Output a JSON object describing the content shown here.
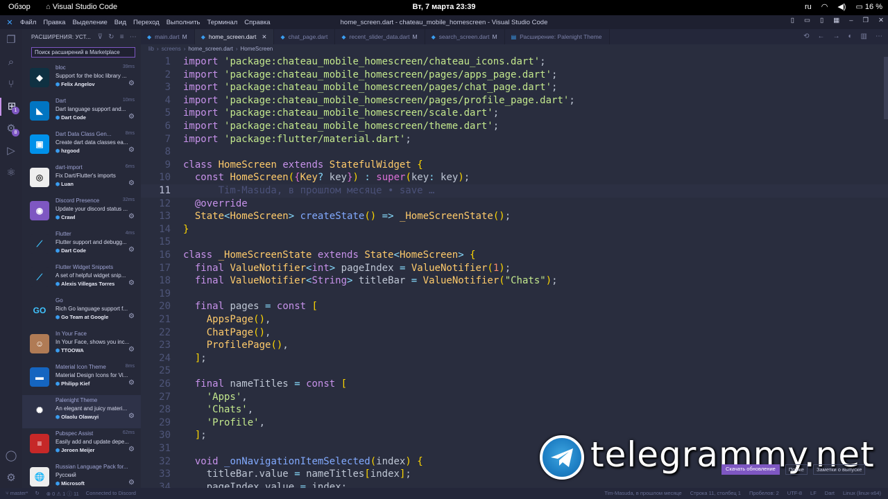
{
  "topbar": {
    "overview": "Обзор",
    "app": "Visual Studio Code",
    "datetime": "Вт, 7 марта  23:39",
    "lang": "ru",
    "battery": "16 %"
  },
  "menu": [
    "Файл",
    "Правка",
    "Выделение",
    "Вид",
    "Переход",
    "Выполнить",
    "Терминал",
    "Справка"
  ],
  "window_title": "home_screen.dart - chateau_mobile_homescreen - Visual Studio Code",
  "sidebar": {
    "title": "РАСШИРЕНИЯ: УСТ...",
    "search_placeholder": "Поиск расширений в Marketplace",
    "extensions": [
      {
        "name": "bloc",
        "time": "39ms",
        "desc": "Support for the bloc library ...",
        "publisher": "Felix Angelov",
        "icon_color": "#0f3142",
        "glyph": "◆"
      },
      {
        "name": "Dart",
        "time": "10ms",
        "desc": "Dart language support and...",
        "publisher": "Dart Code",
        "icon_color": "#0175c2",
        "glyph": "◣"
      },
      {
        "name": "Dart Data Class Gen...",
        "time": "8ms",
        "desc": "Create dart data classes ea...",
        "publisher": "hzgood",
        "icon_color": "#0091ea",
        "glyph": "▣"
      },
      {
        "name": "dart-import",
        "time": "6ms",
        "desc": "Fix Dart/Flutter's imports",
        "publisher": "Luan",
        "icon_color": "#eeeeee",
        "glyph": "◎"
      },
      {
        "name": "Discord Presence",
        "time": "32ms",
        "desc": "Update your discord status ...",
        "publisher": "Crawl",
        "icon_color": "#7e57c2",
        "glyph": "◉"
      },
      {
        "name": "Flutter",
        "time": "4ms",
        "desc": "Flutter support and debugg...",
        "publisher": "Dart Code",
        "icon_color": "#262939",
        "glyph": "⟋"
      },
      {
        "name": "Flutter Widget Snippets",
        "time": "",
        "desc": "A set of helpful widget snip...",
        "publisher": "Alexis Villegas Torres",
        "icon_color": "#262939",
        "glyph": "⟋"
      },
      {
        "name": "Go",
        "time": "",
        "desc": "Rich Go language support f...",
        "publisher": "Go Team at Google",
        "icon_color": "#262939",
        "glyph": "GO"
      },
      {
        "name": "In Your Face",
        "time": "",
        "desc": "In Your Face, shows you inc...",
        "publisher": "TTOOWA",
        "icon_color": "#b07b55",
        "glyph": "☺"
      },
      {
        "name": "Material Icon Theme",
        "time": "8ms",
        "desc": "Material Design Icons for Vi...",
        "publisher": "Philipp Kief",
        "icon_color": "#1565c0",
        "glyph": "▬"
      },
      {
        "name": "Palenight Theme",
        "time": "",
        "desc": "An elegant and juicy materi...",
        "publisher": "Olaolu Olawuyi",
        "icon_color": "#2e3248",
        "glyph": "✺"
      },
      {
        "name": "Pubspec Assist",
        "time": "62ms",
        "desc": "Easily add and update depe...",
        "publisher": "Jeroen Meijer",
        "icon_color": "#c62828",
        "glyph": "≡"
      },
      {
        "name": "Russian Language Pack for...",
        "time": "",
        "desc": "Русский",
        "publisher": "Microsoft",
        "icon_color": "#eeeeee",
        "glyph": "🌐"
      }
    ]
  },
  "tabs": [
    {
      "label": "main.dart",
      "mod": "M"
    },
    {
      "label": "home_screen.dart",
      "mod": ""
    },
    {
      "label": "chat_page.dart",
      "mod": ""
    },
    {
      "label": "recent_slider_data.dart",
      "mod": "M"
    },
    {
      "label": "search_screen.dart",
      "mod": "M"
    },
    {
      "label": "Расширение: Palenight Theme",
      "mod": ""
    }
  ],
  "breadcrumb": [
    "lib",
    "screens",
    "home_screen.dart",
    "HomeScreen"
  ],
  "watermark": "telegrammy.net",
  "notification": {
    "update": "Скачать обновление",
    "later": "Позже",
    "release": "Заметки о выпуске"
  },
  "status": {
    "branch": "master*",
    "problems": "⊗ 0 ⚠ 1 ⓘ 11",
    "discord": "Connected to Discord",
    "blame": "Tim-Masuda, в прошлом месяце",
    "pos": "Строка 11, столбец 1",
    "spaces": "Пробелов: 2",
    "enc": "UTF-8",
    "eol": "LF",
    "lang": "Dart",
    "plat": "Linux (linux-x64)"
  },
  "code_lines": [
    "import 'package:chateau_mobile_homescreen/chateau_icons.dart';",
    "import 'package:chateau_mobile_homescreen/pages/apps_page.dart';",
    "import 'package:chateau_mobile_homescreen/pages/chat_page.dart';",
    "import 'package:chateau_mobile_homescreen/pages/profile_page.dart';",
    "import 'package:chateau_mobile_homescreen/scale.dart';",
    "import 'package:chateau_mobile_homescreen/theme.dart';",
    "import 'package:flutter/material.dart';",
    "",
    "class HomeScreen extends StatefulWidget {",
    "  const HomeScreen({Key? key}) : super(key: key);",
    "      Tim-Masuda, в прошлом месяце • save …",
    "  @override",
    "  State<HomeScreen> createState() => _HomeScreenState();",
    "}",
    "",
    "class _HomeScreenState extends State<HomeScreen> {",
    "  final ValueNotifier<int> pageIndex = ValueNotifier(1);",
    "  final ValueNotifier<String> titleBar = ValueNotifier(\"Chats\");",
    "",
    "  final pages = const [",
    "    AppsPage(),",
    "    ChatPage(),",
    "    ProfilePage(),",
    "  ];",
    "",
    "  final nameTitles = const [",
    "    'Apps',",
    "    'Chats',",
    "    'Profile',",
    "  ];",
    "",
    "  void _onNavigationItemSelected(index) {",
    "    titleBar.value = nameTitles[index];",
    "    pageIndex.value = index;"
  ],
  "current_line": 11
}
